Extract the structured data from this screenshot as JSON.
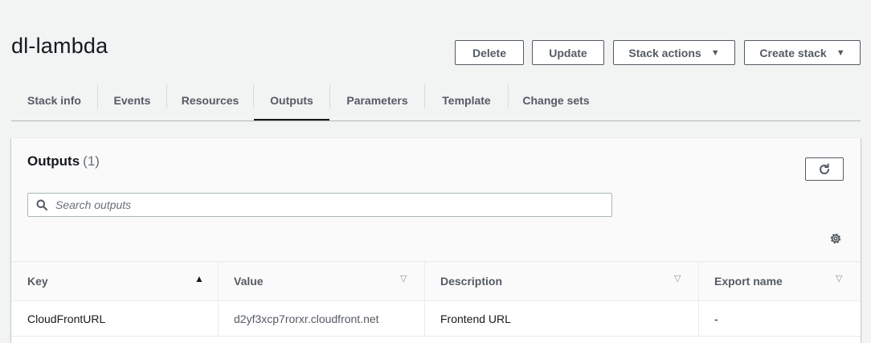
{
  "stack": {
    "name": "dl-lambda"
  },
  "actions": {
    "delete_label": "Delete",
    "update_label": "Update",
    "stack_actions_label": "Stack actions",
    "create_stack_label": "Create stack"
  },
  "tabs": [
    {
      "label": "Stack info",
      "active": false
    },
    {
      "label": "Events",
      "active": false
    },
    {
      "label": "Resources",
      "active": false
    },
    {
      "label": "Outputs",
      "active": true
    },
    {
      "label": "Parameters",
      "active": false
    },
    {
      "label": "Template",
      "active": false
    },
    {
      "label": "Change sets",
      "active": false
    }
  ],
  "outputs": {
    "title": "Outputs",
    "count": "(1)",
    "search_placeholder": "Search outputs",
    "columns": [
      {
        "label": "Key",
        "sort": "ascending"
      },
      {
        "label": "Value",
        "sort": "none"
      },
      {
        "label": "Description",
        "sort": "none"
      },
      {
        "label": "Export name",
        "sort": "none"
      }
    ],
    "rows": [
      {
        "key": "CloudFrontURL",
        "value": "d2yf3xcp7rorxr.cloudfront.net",
        "description": "Frontend URL",
        "export_name": "-"
      }
    ]
  },
  "icons": {
    "caret": "caret-down-icon",
    "refresh": "refresh-icon",
    "search": "search-icon",
    "settings": "gear-icon",
    "sort_asc": "sort-ascending-icon",
    "sort_none": "sort-neutral-icon"
  },
  "colors": {
    "background": "#f2f3f3",
    "text": "#16191f",
    "secondary_text": "#545b64",
    "border": "#aab7b8"
  }
}
